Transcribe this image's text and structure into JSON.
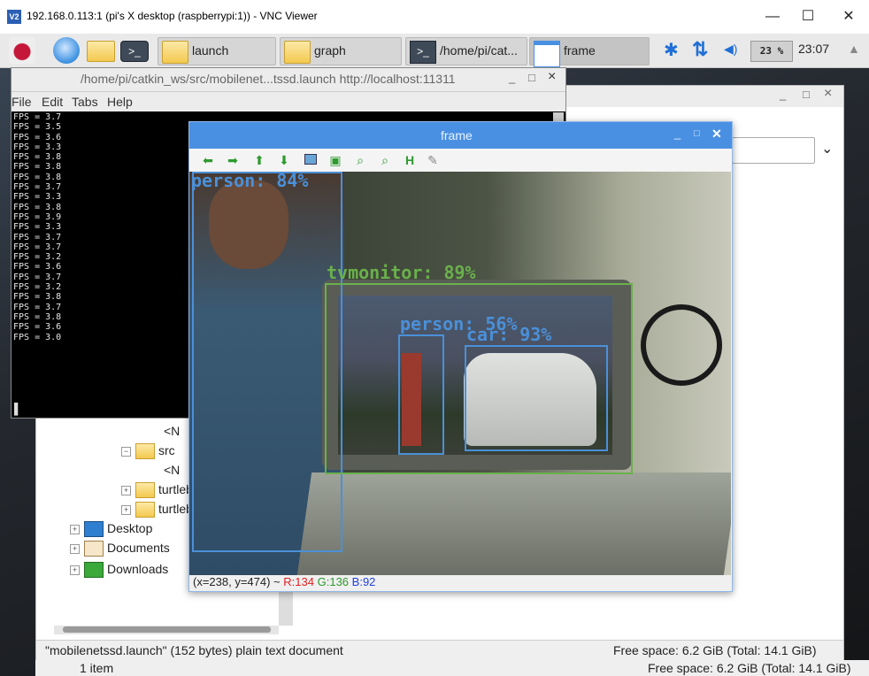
{
  "vnc": {
    "title": "192.168.0.113:1 (pi's X desktop (raspberrypi:1)) - VNC Viewer",
    "icon_label": "V2",
    "min_glyph": "—",
    "max_glyph": "☐",
    "close_glyph": "✕"
  },
  "taskbar": {
    "tasks": [
      {
        "label": "launch"
      },
      {
        "label": "graph"
      },
      {
        "label": "/home/pi/cat..."
      },
      {
        "label": "frame"
      }
    ],
    "cpu": "23 %",
    "clock": "23:07",
    "eject_glyph": "▲",
    "bluetooth_glyph": "✱",
    "network_glyph": "⇅",
    "volume_glyph": "◀)"
  },
  "terminal": {
    "title": "/home/pi/catkin_ws/src/mobilenet...tssd.launch http://localhost:11311",
    "menu": [
      "File",
      "Edit",
      "Tabs",
      "Help"
    ],
    "output": "FPS = 3.7\nFPS = 3.5\nFPS = 3.6\nFPS = 3.3\nFPS = 3.8\nFPS = 3.8\nFPS = 3.8\nFPS = 3.7\nFPS = 3.3\nFPS = 3.8\nFPS = 3.9\nFPS = 3.3\nFPS = 3.7\nFPS = 3.7\nFPS = 3.2\nFPS = 3.6\nFPS = 3.7\nFPS = 3.2\nFPS = 3.8\nFPS = 3.7\nFPS = 3.8\nFPS = 3.6\nFPS = 3.0",
    "cursor": "▌",
    "min_glyph": "_",
    "max_glyph": "□",
    "close_glyph": "×"
  },
  "file_manager": {
    "tree": [
      {
        "label": "<N",
        "indent": 3,
        "type": "text"
      },
      {
        "label": "src",
        "indent": 2,
        "type": "folder",
        "toggle": "−"
      },
      {
        "label": "<N",
        "indent": 3,
        "type": "text"
      },
      {
        "label": "turtlebc",
        "indent": 2,
        "type": "folder",
        "toggle": "+"
      },
      {
        "label": "turtlebc",
        "indent": 2,
        "type": "folder",
        "toggle": "+"
      },
      {
        "label": "Desktop",
        "indent": 1,
        "type": "desktop",
        "toggle": "+"
      },
      {
        "label": "Documents",
        "indent": 1,
        "type": "documents",
        "toggle": "+"
      },
      {
        "label": "Downloads",
        "indent": 1,
        "type": "downloads",
        "toggle": "+"
      }
    ],
    "status_left": "\"mobilenetssd.launch\" (152 bytes) plain text document",
    "status_right": "Free space: 6.2 GiB (Total: 14.1 GiB)",
    "bg_status_left": "1 item",
    "bg_status_right": "Free space: 6.2 GiB (Total: 14.1 GiB)",
    "min_glyph": "_",
    "max_glyph": "□",
    "close_glyph": "×",
    "dropdown_glyph": "⌄"
  },
  "frame": {
    "title": "frame",
    "min_glyph": "_",
    "max_glyph": "□",
    "close_glyph": "✕",
    "detections": [
      {
        "label": "person: 84%",
        "color": "#4a90d9"
      },
      {
        "label": "tvmonitor: 89%",
        "color": "#6ab04c"
      },
      {
        "label": "person: 56%",
        "color": "#4a90d9"
      },
      {
        "label": "car: 93%",
        "color": "#4a90d9"
      }
    ],
    "status_coords": "(x=238, y=474) ~",
    "status_r": "R:134",
    "status_g": "G:136",
    "status_b": "B:92",
    "r_color": "#e02020",
    "g_color": "#2a9a2a",
    "b_color": "#2040e0"
  }
}
